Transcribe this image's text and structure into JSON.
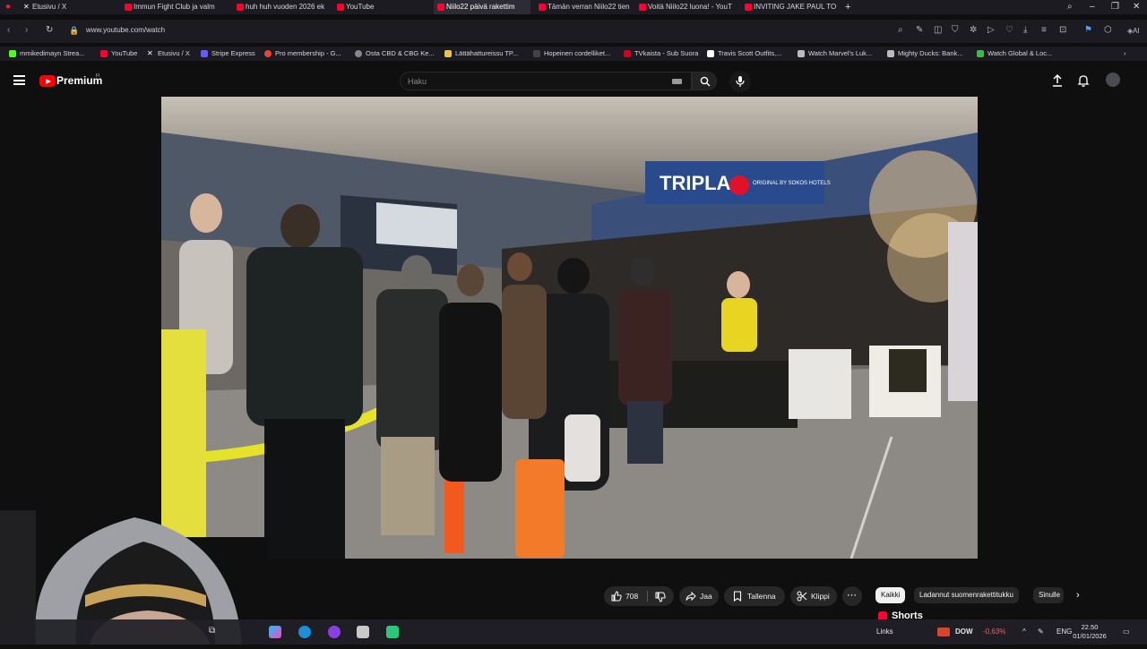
{
  "browser": {
    "tabs": [
      {
        "title": "Etusivu / X",
        "color": "#ffffff"
      },
      {
        "title": "Immun Fight Club ja valm",
        "color": "#ff0033"
      },
      {
        "title": "huh huh vuoden 2026 ek",
        "color": "#ff0033"
      },
      {
        "title": "YouTube",
        "color": "#ff0033"
      },
      {
        "title": "Niilo22 päivä rakettim",
        "color": "#ff0033"
      },
      {
        "title": "Tämän verran Niilo22 tien",
        "color": "#ff0033"
      },
      {
        "title": "Voitä Niilo22 luona! - YouT",
        "color": "#ff0033"
      },
      {
        "title": "INVITING JAKE PAUL TO TI",
        "color": "#ff0033"
      }
    ],
    "new_tab": "+",
    "url": "www.youtube.com/watch",
    "bookmarks": [
      {
        "label": "mmikedimayn Strea...",
        "color": "#53fc18"
      },
      {
        "label": "YouTube",
        "color": "#ff0033"
      },
      {
        "label": "Etusivu / X",
        "color": "#ffffff"
      },
      {
        "label": "Stripe Express",
        "color": "#635bff"
      },
      {
        "label": "Pro membership - G...",
        "color": "#ea4335"
      },
      {
        "label": "Osta CBD & CBG Ke...",
        "color": "#888888"
      },
      {
        "label": "Lättähattureissu TP...",
        "color": "#e8c547"
      },
      {
        "label": "Hopeinen cordelliket...",
        "color": "#444444"
      },
      {
        "label": "TVkaista - Sub Suora",
        "color": "#d0021b"
      },
      {
        "label": "Travis Scott Outfits,...",
        "color": "#ffffff"
      },
      {
        "label": "Watch Marvel's Luk...",
        "color": "#bbbbbb"
      },
      {
        "label": "Mighty Ducks: Bank...",
        "color": "#bbbbbb"
      },
      {
        "label": "Watch Global & Loc...",
        "color": "#3dba4e"
      }
    ]
  },
  "youtube": {
    "brand": "Premium",
    "region": "FI",
    "search_placeholder": "Haku",
    "like_count": "708",
    "share_label": "Jaa",
    "save_label": "Tallenna",
    "clip_label": "Klippi",
    "chips": [
      "Kaikki",
      "Ladannut suomenrakettitukku",
      "Sinulle"
    ],
    "shorts_label": "Shorts",
    "video_sign": "TRIPLA",
    "video_sign_sub": "ORIGINAL BY SOKOS HOTELS"
  },
  "taskbar": {
    "links_label": "Links",
    "ticker": "DOW",
    "ticker_change": "-0,63%",
    "lang": "ENG",
    "time": "22.50",
    "date": "01/01/2026"
  },
  "colors": {
    "accent": "#ff0000",
    "ticker_down": "#ff5b5b"
  }
}
